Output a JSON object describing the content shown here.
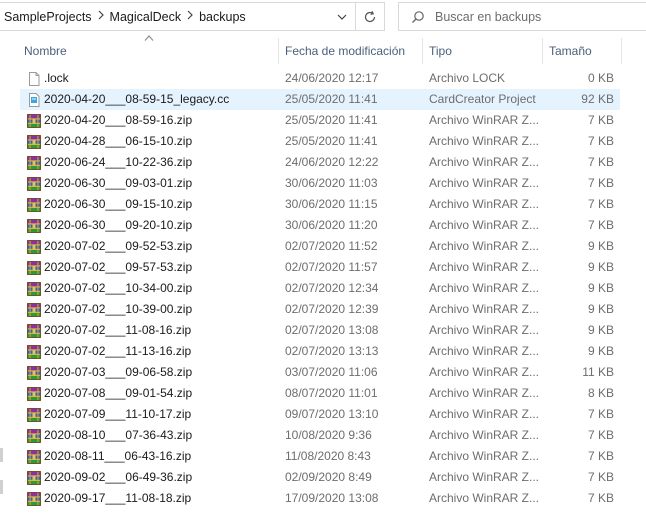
{
  "breadcrumb": [
    "SampleProjects",
    "MagicalDeck",
    "backups"
  ],
  "search": {
    "placeholder": "Buscar en backups"
  },
  "columns": {
    "name": "Nombre",
    "date": "Fecha de modificación",
    "type": "Tipo",
    "size": "Tamaño"
  },
  "icons": {
    "lock": "generic-file-icon",
    "cc": "cardcreator-file-icon",
    "zip": "winrar-archive-icon"
  },
  "colors": {
    "selected_row": "#e5f3ff",
    "header_text": "#4c607a",
    "secondary_text": "#6d6d6d"
  },
  "files": [
    {
      "name": ".lock",
      "date": "24/06/2020 12:17",
      "type": "Archivo LOCK",
      "size": "0 KB",
      "icon": "lock"
    },
    {
      "name": "2020-04-20___08-59-15_legacy.cc",
      "date": "25/05/2020 11:41",
      "type": "CardCreator Project",
      "size": "92 KB",
      "icon": "cc",
      "selected": true
    },
    {
      "name": "2020-04-20___08-59-16.zip",
      "date": "25/05/2020 11:41",
      "type": "Archivo WinRAR Z...",
      "size": "7 KB",
      "icon": "zip"
    },
    {
      "name": "2020-04-28___06-15-10.zip",
      "date": "25/05/2020 11:41",
      "type": "Archivo WinRAR Z...",
      "size": "7 KB",
      "icon": "zip"
    },
    {
      "name": "2020-06-24___10-22-36.zip",
      "date": "24/06/2020 12:22",
      "type": "Archivo WinRAR Z...",
      "size": "7 KB",
      "icon": "zip"
    },
    {
      "name": "2020-06-30___09-03-01.zip",
      "date": "30/06/2020 11:03",
      "type": "Archivo WinRAR Z...",
      "size": "7 KB",
      "icon": "zip"
    },
    {
      "name": "2020-06-30___09-15-10.zip",
      "date": "30/06/2020 11:15",
      "type": "Archivo WinRAR Z...",
      "size": "7 KB",
      "icon": "zip"
    },
    {
      "name": "2020-06-30___09-20-10.zip",
      "date": "30/06/2020 11:20",
      "type": "Archivo WinRAR Z...",
      "size": "7 KB",
      "icon": "zip"
    },
    {
      "name": "2020-07-02___09-52-53.zip",
      "date": "02/07/2020 11:52",
      "type": "Archivo WinRAR Z...",
      "size": "9 KB",
      "icon": "zip"
    },
    {
      "name": "2020-07-02___09-57-53.zip",
      "date": "02/07/2020 11:57",
      "type": "Archivo WinRAR Z...",
      "size": "9 KB",
      "icon": "zip"
    },
    {
      "name": "2020-07-02___10-34-00.zip",
      "date": "02/07/2020 12:34",
      "type": "Archivo WinRAR Z...",
      "size": "9 KB",
      "icon": "zip"
    },
    {
      "name": "2020-07-02___10-39-00.zip",
      "date": "02/07/2020 12:39",
      "type": "Archivo WinRAR Z...",
      "size": "9 KB",
      "icon": "zip"
    },
    {
      "name": "2020-07-02___11-08-16.zip",
      "date": "02/07/2020 13:08",
      "type": "Archivo WinRAR Z...",
      "size": "9 KB",
      "icon": "zip"
    },
    {
      "name": "2020-07-02___11-13-16.zip",
      "date": "02/07/2020 13:13",
      "type": "Archivo WinRAR Z...",
      "size": "9 KB",
      "icon": "zip"
    },
    {
      "name": "2020-07-03___09-06-58.zip",
      "date": "03/07/2020 11:06",
      "type": "Archivo WinRAR Z...",
      "size": "11 KB",
      "icon": "zip"
    },
    {
      "name": "2020-07-08___09-01-54.zip",
      "date": "08/07/2020 11:01",
      "type": "Archivo WinRAR Z...",
      "size": "8 KB",
      "icon": "zip"
    },
    {
      "name": "2020-07-09___11-10-17.zip",
      "date": "09/07/2020 13:10",
      "type": "Archivo WinRAR Z...",
      "size": "7 KB",
      "icon": "zip"
    },
    {
      "name": "2020-08-10___07-36-43.zip",
      "date": "10/08/2020 9:36",
      "type": "Archivo WinRAR Z...",
      "size": "7 KB",
      "icon": "zip"
    },
    {
      "name": "2020-08-11___06-43-16.zip",
      "date": "11/08/2020 8:43",
      "type": "Archivo WinRAR Z...",
      "size": "7 KB",
      "icon": "zip"
    },
    {
      "name": "2020-09-02___06-49-36.zip",
      "date": "02/09/2020 8:49",
      "type": "Archivo WinRAR Z...",
      "size": "7 KB",
      "icon": "zip"
    },
    {
      "name": "2020-09-17___11-08-18.zip",
      "date": "17/09/2020 13:08",
      "type": "Archivo WinRAR Z...",
      "size": "7 KB",
      "icon": "zip"
    }
  ]
}
